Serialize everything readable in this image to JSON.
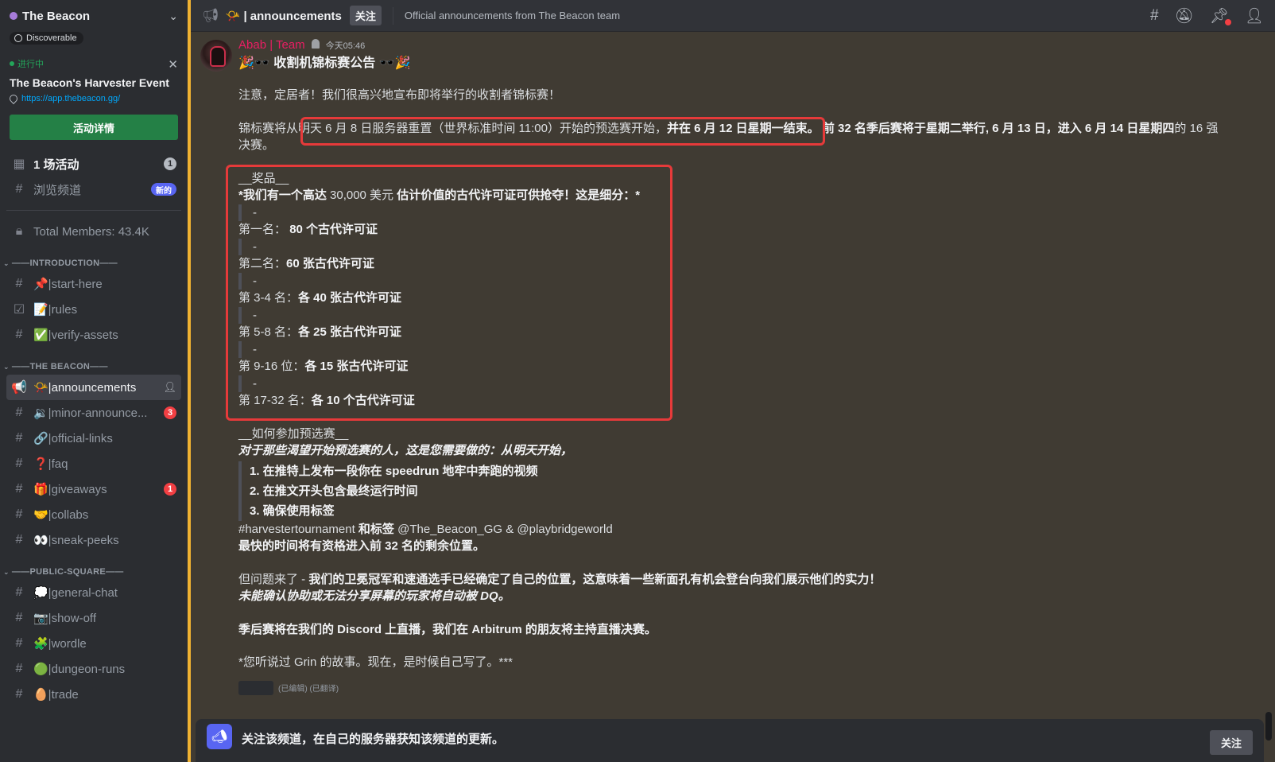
{
  "server": {
    "name": "The Beacon",
    "discoverable": "Discoverable"
  },
  "event": {
    "status": "进行中",
    "title": "The Beacon's Harvester Event",
    "link": "https://app.thebeacon.gg/",
    "button": "活动详情"
  },
  "top_nav": [
    {
      "icon": "calendar-icon",
      "label": "1 场活动",
      "badge": "1"
    },
    {
      "icon": "browse-channels-icon",
      "label": "浏览频道",
      "badge": "新的"
    }
  ],
  "members": "Total Members: 43.4K",
  "categories": [
    {
      "name": "——INTRODUCTION——",
      "channels": [
        {
          "prefix": "#",
          "label": "📌|start-here"
        },
        {
          "prefix": "☑",
          "label": "📝|rules"
        },
        {
          "prefix": "#",
          "label": "✅|verify-assets"
        }
      ]
    },
    {
      "name": "——THE BEACON——",
      "channels": [
        {
          "prefix": "📢",
          "label": "📯|announcements",
          "active": true
        },
        {
          "prefix": "#",
          "label": "🔉|minor-announce...",
          "badge": "3"
        },
        {
          "prefix": "#",
          "label": "🔗|official-links"
        },
        {
          "prefix": "#",
          "label": "❓|faq"
        },
        {
          "prefix": "#",
          "label": "🎁|giveaways",
          "badge": "1"
        },
        {
          "prefix": "#",
          "label": "🤝|collabs"
        },
        {
          "prefix": "#",
          "label": "👀|sneak-peeks"
        }
      ]
    },
    {
      "name": "——PUBLIC-SQUARE——",
      "channels": [
        {
          "prefix": "#",
          "label": "💭|general-chat"
        },
        {
          "prefix": "#",
          "label": "📷|show-off"
        },
        {
          "prefix": "#",
          "label": "🧩|wordle"
        },
        {
          "prefix": "#",
          "label": "🟢|dungeon-runs"
        },
        {
          "prefix": "#",
          "label": "🥚|trade"
        }
      ]
    }
  ],
  "header": {
    "channel": "📯 | announcements",
    "follow": "关注",
    "topic": "Official announcements from The Beacon team"
  },
  "message": {
    "author": "Abab | Team",
    "timestamp": "今天05:46",
    "title": "🎉🕶️ 收割机锦标赛公告 🕶️🎉",
    "p1": "注意，定居者！我们很高兴地宣布即将举行的收割者锦标赛！",
    "p2a": "锦标赛将从明天 6 月 8 日服务器重置（世界标准时间 11:00）开始的预选赛开始，",
    "p2b": "并在 6 月 12 日星期一结束。",
    "p2c": " 前 32 名季后赛将于星期二举行, 6 月 13 日，",
    "p2d": "进入 6 月 14 日星期四",
    "p2e": "的 16 强决赛。",
    "prizes_head": "__奖品__",
    "prizes_intro_a": "*我们有一个高达 ",
    "prizes_intro_b": "30,000 美元",
    "prizes_intro_c": " 估计价值的古代许可证可供抢夺！这是细分：*",
    "dash": "-",
    "prizes": [
      {
        "rank": "第一名：",
        "reward": "80 个古代许可证"
      },
      {
        "rank": " 第二名：",
        "reward": "60 张古代许可证"
      },
      {
        "rank": "第 3-4 名：",
        "reward": "各 40 张古代许可证"
      },
      {
        "rank": "第 5-8 名：",
        "reward": "各 25 张古代许可证"
      },
      {
        "rank": "第 9-16 位：",
        "reward": "各 15 张古代许可证"
      },
      {
        "rank": "第 17-32 名：",
        "reward": "各 10 个古代许可证"
      }
    ],
    "join_head": "__如何参加预选赛__",
    "join_intro": "对于那些渴望开始预选赛的人，这是您需要做的：从明天开始，",
    "steps": [
      "1. 在推特上发布一段你在 speedrun 地牢中奔跑的视频",
      "2. 在推文开头包含最终运行时间",
      "3. 确保使用标签"
    ],
    "hashtag_a": "#harvestertournament",
    "hashtag_b": " 和标签 ",
    "hashtag_c": "@The_Beacon_GG & @playbridgeworld",
    "fastest": "最快的时间将有资格进入前 32 名的剩余位置。",
    "twist_a": "但问题来了 - ",
    "twist_b": "我们的卫冕冠军和速通选手已经确定了自己的位置，这意味着一些新面孔有机会登台向我们展示他们的实力！",
    "dq": "未能确认协助或无法分享屏幕的玩家将自动被 DQ。",
    "stream": "季后赛将在我们的 Discord 上直播，我们在 Arbitrum 的朋友将主持直播决赛。",
    "grin": "*您听说过 Grin 的故事。现在，是时候自己写了。***",
    "edited": "(已编辑) (已翻译)"
  },
  "follow_banner": {
    "text": "关注该频道，在自己的服务器获知该频道的更新。",
    "button": "关注"
  }
}
